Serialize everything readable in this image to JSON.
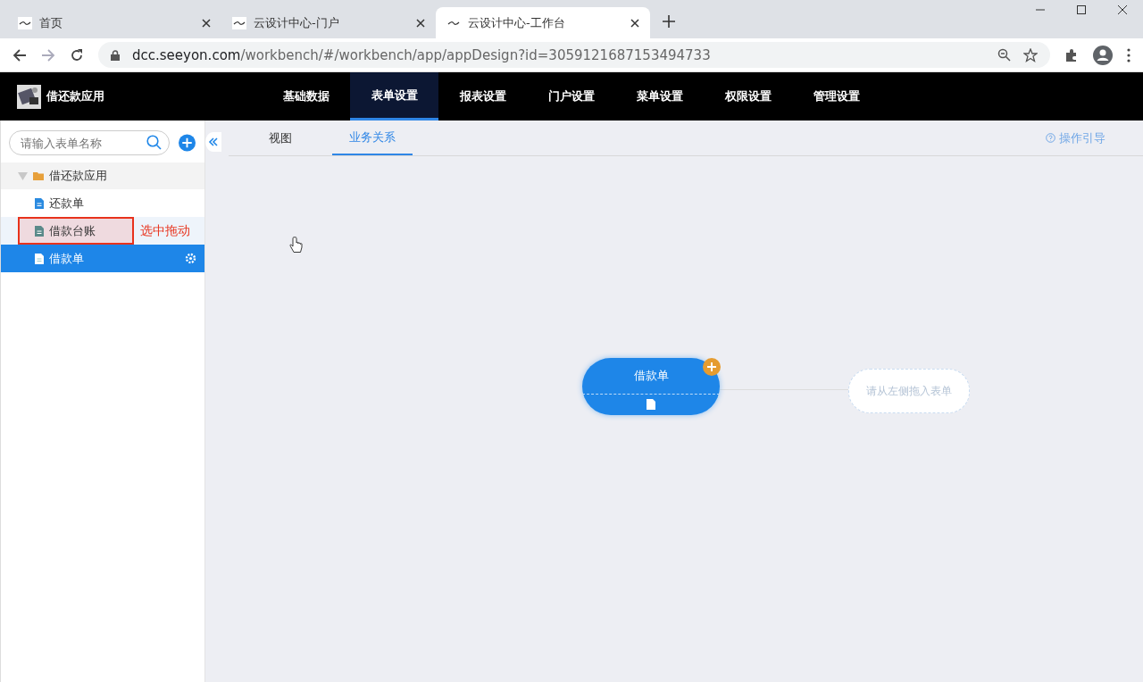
{
  "browser": {
    "tabs": [
      {
        "title": "首页",
        "selected": false
      },
      {
        "title": "云设计中心-门户",
        "selected": false
      },
      {
        "title": "云设计中心-工作台",
        "selected": true
      }
    ],
    "url_host": "dcc.seeyon.com",
    "url_path": "/workbench/#/workbench/app/appDesign?id=3059121687153494733"
  },
  "app": {
    "name": "借还款应用",
    "nav": [
      {
        "label": "基础数据",
        "selected": false
      },
      {
        "label": "表单设置",
        "selected": true
      },
      {
        "label": "报表设置",
        "selected": false
      },
      {
        "label": "门户设置",
        "selected": false
      },
      {
        "label": "菜单设置",
        "selected": false
      },
      {
        "label": "权限设置",
        "selected": false
      },
      {
        "label": "管理设置",
        "selected": false
      }
    ]
  },
  "sidebar": {
    "search": {
      "placeholder": "请输入表单名称"
    },
    "tree": [
      {
        "label": "借还款应用",
        "expanded": true,
        "children": [
          {
            "label": "还款单",
            "selected": false,
            "marked": false
          },
          {
            "label": "借款台账",
            "selected": false,
            "marked": true
          },
          {
            "label": "借款单",
            "selected": true,
            "marked": false
          }
        ]
      }
    ]
  },
  "annotation": {
    "label": "选中拖动"
  },
  "subtabs": [
    {
      "label": "视图",
      "selected": false
    },
    {
      "label": "业务关系",
      "selected": true
    }
  ],
  "guide_link": "操作引导",
  "canvas": {
    "node": {
      "label": "借款单"
    },
    "drop_target": {
      "placeholder": "请从左侧拖入表单"
    }
  }
}
